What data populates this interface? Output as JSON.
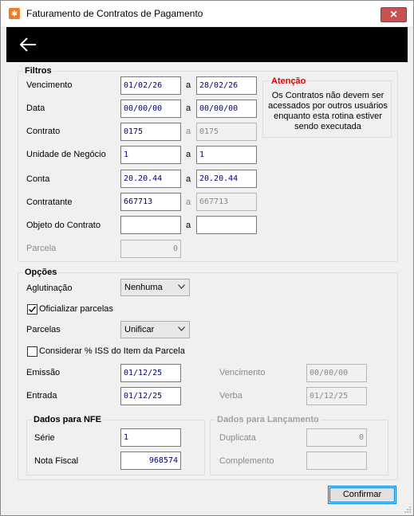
{
  "window": {
    "title": "Faturamento de Contratos de Pagamento",
    "close_label": "✕"
  },
  "filtros": {
    "legend": "Filtros",
    "sep": "a",
    "vencimento": {
      "label": "Vencimento",
      "from": "01/02/26",
      "to": "28/02/26"
    },
    "data": {
      "label": "Data",
      "from": "00/00/00",
      "to": "00/00/00"
    },
    "contrato": {
      "label": "Contrato",
      "from": "0175",
      "to": "0175"
    },
    "unidade": {
      "label": "Unidade de Negócio",
      "from": "1",
      "to": "1"
    },
    "conta": {
      "label": "Conta",
      "from": "20.20.44",
      "to": "20.20.44"
    },
    "contratante": {
      "label": "Contratante",
      "from": "667713",
      "to": "667713"
    },
    "objeto": {
      "label": "Objeto do Contrato",
      "from": "",
      "to": ""
    },
    "parcela": {
      "label": "Parcela",
      "value": "0"
    }
  },
  "atencao": {
    "title": "Atenção",
    "text": "Os Contratos não devem ser acessados por outros usuários enquanto esta rotina estiver sendo executada"
  },
  "opcoes": {
    "legend": "Opções",
    "aglutinacao": {
      "label": "Aglutinação",
      "value": "Nenhuma"
    },
    "oficializar": {
      "label": "Oficializar parcelas",
      "checked": true
    },
    "parcelas": {
      "label": "Parcelas",
      "value": "Unificar"
    },
    "considerar_iss": {
      "label": "Considerar % ISS do Item da Parcela",
      "checked": false
    },
    "emissao": {
      "label": "Emissão",
      "value": "01/12/25"
    },
    "entrada": {
      "label": "Entrada",
      "value": "01/12/25"
    },
    "vencimento": {
      "label": "Vencimento",
      "value": "00/00/00"
    },
    "verba": {
      "label": "Verba",
      "value": "01/12/25"
    }
  },
  "nfe": {
    "legend": "Dados para NFE",
    "serie": {
      "label": "Série",
      "value": "1"
    },
    "nota_fiscal": {
      "label": "Nota Fiscal",
      "value": "968574"
    }
  },
  "lancamento": {
    "legend": "Dados para Lançamento",
    "duplicata": {
      "label": "Duplicata",
      "value": "0"
    },
    "complemento": {
      "label": "Complemento",
      "value": ""
    }
  },
  "footer": {
    "confirm_label": "Confirmar"
  }
}
